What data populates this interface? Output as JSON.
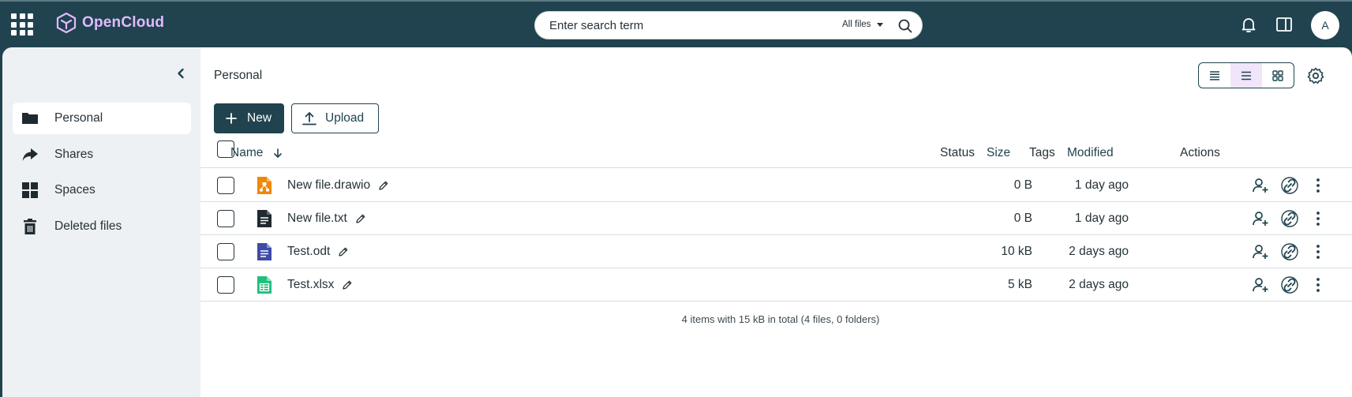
{
  "app": {
    "name": "OpenCloud"
  },
  "search": {
    "placeholder": "Enter search term",
    "filter_label": "All files"
  },
  "user": {
    "avatar_initial": "A"
  },
  "sidebar": {
    "items": [
      {
        "label": "Personal",
        "icon": "folder-icon",
        "active": true
      },
      {
        "label": "Shares",
        "icon": "share-icon",
        "active": false
      },
      {
        "label": "Spaces",
        "icon": "spaces-icon",
        "active": false
      },
      {
        "label": "Deleted files",
        "icon": "trash-icon",
        "active": false
      }
    ]
  },
  "breadcrumb": {
    "current": "Personal"
  },
  "toolbar": {
    "new_label": "New",
    "upload_label": "Upload"
  },
  "table": {
    "columns": {
      "name": "Name",
      "status": "Status",
      "size": "Size",
      "tags": "Tags",
      "modified": "Modified",
      "actions": "Actions"
    },
    "rows": [
      {
        "name": "New file.drawio",
        "type": "drawio",
        "size": "0 B",
        "modified": "1 day ago"
      },
      {
        "name": "New file.txt",
        "type": "text",
        "size": "0 B",
        "modified": "1 day ago"
      },
      {
        "name": "Test.odt",
        "type": "document",
        "size": "10 kB",
        "modified": "2 days ago"
      },
      {
        "name": "Test.xlsx",
        "type": "spreadsheet",
        "size": "5 kB",
        "modified": "2 days ago"
      }
    ]
  },
  "footer": {
    "summary": "4 items with 15 kB in total (4 files, 0 folders)"
  },
  "colors": {
    "brand_dark": "#20434f",
    "logo": "#e2baff",
    "drawio": "#f08705",
    "document": "#3f4ba6",
    "spreadsheet": "#1fbf7b"
  }
}
